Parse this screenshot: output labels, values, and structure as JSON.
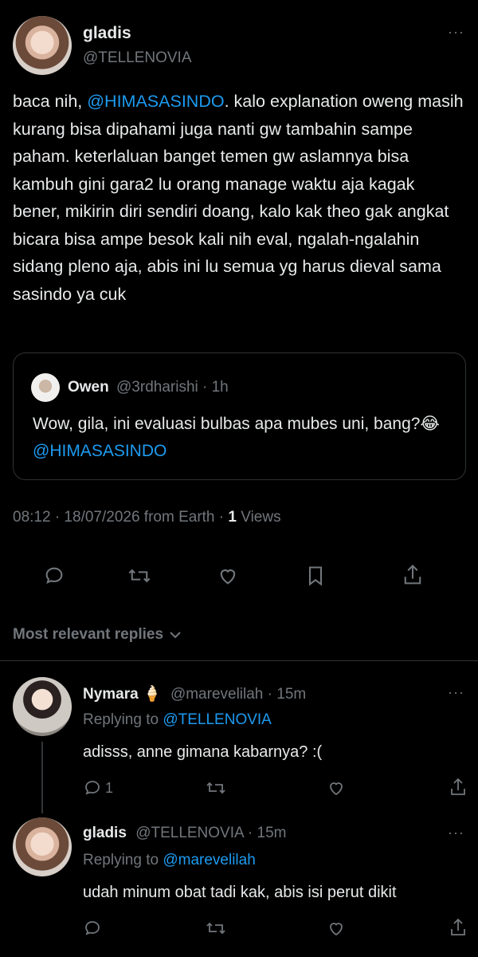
{
  "main_tweet": {
    "name": "gladis",
    "handle": "@TELLENOVIA",
    "text_prefix": "baca nih, ",
    "mention": "@HIMASASINDO",
    "text_suffix": ". kalo explanation oweng masih kurang bisa dipahami juga nanti gw tambahin sampe paham. keterlaluan banget temen gw aslamnya bisa kambuh gini gara2 lu orang manage waktu aja kagak bener, mikirin diri sendiri doang, kalo kak theo gak angkat bicara bisa ampe besok kali nih eval, ngalah-ngalahin sidang pleno aja, abis ini lu semua yg harus dieval sama sasindo ya cuk",
    "more": "···",
    "meta_time": "08:12 · 18/07/2026 from Earth · ",
    "views_count": "1",
    "views_label": " Views"
  },
  "quote": {
    "name": "Owen",
    "handle_time": "@3rdharishi · 1h",
    "text": "Wow, gila, ini evaluasi bulbas apa mubes uni, bang?😂 ",
    "mention": "@HIMASASINDO"
  },
  "actions": {
    "icons": [
      "reply-icon",
      "retweet-icon",
      "like-icon",
      "bookmark-icon",
      "share-icon"
    ]
  },
  "replies_header": {
    "label": "Most relevant replies",
    "chevron": "⌄"
  },
  "replies": [
    {
      "name": "Nymara 🍦",
      "handle_time": "@marevelilah · 15m",
      "replying_prefix": "Replying to ",
      "replying_to": "@TELLENOVIA",
      "text": "adisss, anne gimana kabarnya? :(",
      "reply_count": "1",
      "more": "···"
    },
    {
      "name": "gladis",
      "handle_time": "@TELLENOVIA · 15m",
      "replying_prefix": "Replying to ",
      "replying_to": "@marevelilah",
      "text": "udah minum obat tadi kak, abis isi perut dikit",
      "reply_count": "",
      "more": "···"
    }
  ]
}
